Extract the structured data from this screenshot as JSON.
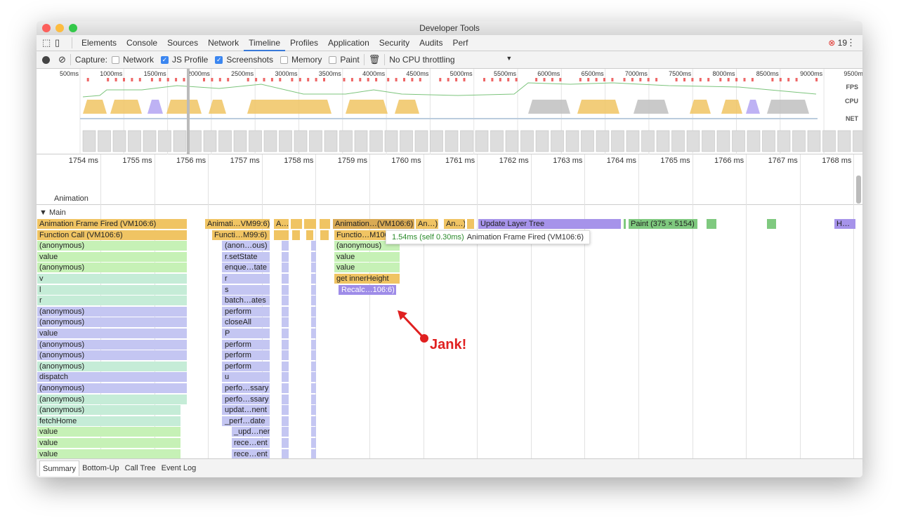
{
  "window": {
    "title": "Developer Tools"
  },
  "tabs": [
    "Elements",
    "Console",
    "Sources",
    "Network",
    "Timeline",
    "Profiles",
    "Application",
    "Security",
    "Audits",
    "Perf"
  ],
  "selected_tab": "Timeline",
  "error_count": "19",
  "toolbar": {
    "capture_label": "Capture:",
    "options": [
      {
        "label": "Network",
        "checked": false
      },
      {
        "label": "JS Profile",
        "checked": true
      },
      {
        "label": "Screenshots",
        "checked": true
      },
      {
        "label": "Memory",
        "checked": false
      },
      {
        "label": "Paint",
        "checked": false
      }
    ],
    "throttling": "No CPU throttling"
  },
  "overview": {
    "ticks": [
      "500ms",
      "1000ms",
      "1500ms",
      "2000ms",
      "2500ms",
      "3000ms",
      "3500ms",
      "4000ms",
      "4500ms",
      "5000ms",
      "5500ms",
      "6000ms",
      "6500ms",
      "7000ms",
      "7500ms",
      "8000ms",
      "8500ms",
      "9000ms",
      "9500ms"
    ],
    "lanes": [
      "FPS",
      "CPU",
      "NET"
    ]
  },
  "ruler": {
    "ticks": [
      "1754 ms",
      "1755 ms",
      "1756 ms",
      "1757 ms",
      "1758 ms",
      "1759 ms",
      "1760 ms",
      "1761 ms",
      "1762 ms",
      "1763 ms",
      "1764 ms",
      "1765 ms",
      "1766 ms",
      "1767 ms",
      "1768 ms"
    ]
  },
  "tracks": {
    "animation": "Animation",
    "main": "Main"
  },
  "flame": {
    "row0": [
      "Animation Frame Fired (VM106:6)",
      "Animati…VM99:6)",
      "A…",
      "Animation…(VM106:6)",
      "An…)",
      "An…)",
      "Update Layer Tree",
      "Paint (375 × 5154)",
      "H…"
    ],
    "row1": [
      "Function Call (VM106:6)",
      "Functi…M99:6)",
      "Functio…M106:6)"
    ],
    "left": [
      "(anonymous)",
      "value",
      "(anonymous)",
      "v",
      "l",
      "r",
      "(anonymous)",
      "(anonymous)",
      "value",
      "(anonymous)",
      "(anonymous)",
      "(anonymous)",
      "dispatch",
      "(anonymous)",
      "(anonymous)",
      "(anonymous)",
      "fetchHome",
      "value",
      "value",
      "value"
    ],
    "mid": [
      "(anon…ous)",
      "r.setState",
      "enque…tate",
      "r",
      "s",
      "batch…ates",
      "perform",
      "closeAll",
      "P",
      "perform",
      "perform",
      "perform",
      "u",
      "perfo…ssary",
      "perfo…ssary",
      "updat…nent",
      "_perf…date",
      "_upd…nent",
      "rece…ent",
      "rece…ent"
    ],
    "jank": [
      "(anonymous)",
      "value",
      "value",
      "get innerHeight",
      "Recalc…106:6)"
    ]
  },
  "tooltip": {
    "time": "1.54ms (self 0.30ms)",
    "label": "Animation Frame Fired (VM106:6)"
  },
  "annotation": "Jank!",
  "bottom_tabs": [
    "Summary",
    "Bottom-Up",
    "Call Tree",
    "Event Log"
  ],
  "colors": {
    "scripting": "#f0c463",
    "js_green": "#c6f1b6",
    "js_teal": "#c5ecd7",
    "js_lavender": "#c4c6f2",
    "rendering": "#b3a4f2",
    "painting": "#7fc97f",
    "accent": "#3879d9",
    "annotation": "#e02020"
  }
}
